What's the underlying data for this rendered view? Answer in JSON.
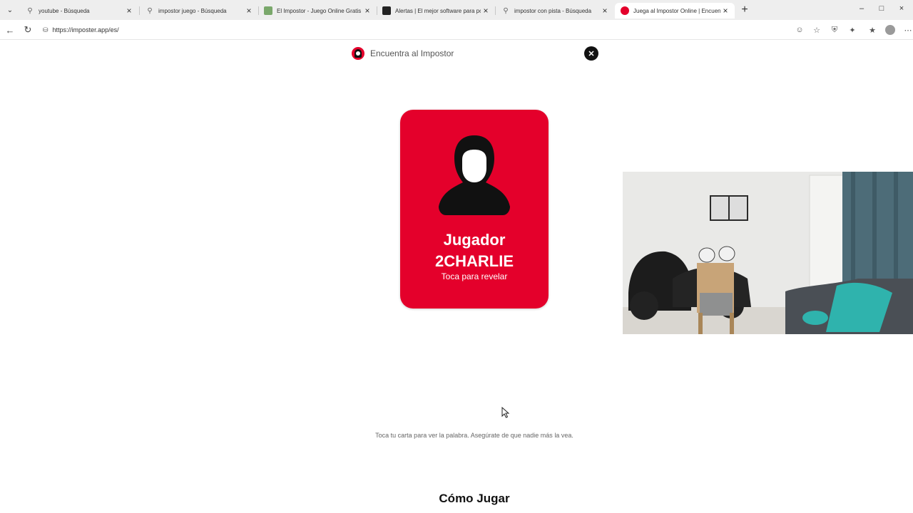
{
  "browser": {
    "tabs": [
      {
        "title": "youtube - Búsqueda",
        "icon": "search-icon",
        "active": false
      },
      {
        "title": "impostor juego - Búsqueda",
        "icon": "search-icon",
        "active": false
      },
      {
        "title": "El Impostor - Juego Online Gratis c",
        "icon": "site-icon",
        "active": false
      },
      {
        "title": "Alertas | El mejor software para pol",
        "icon": "site-icon",
        "active": false
      },
      {
        "title": "impostor con pista - Búsqueda",
        "icon": "search-icon",
        "active": false
      },
      {
        "title": "Juega al Impostor Online | Encuent",
        "icon": "impostor-logo-icon",
        "active": true
      }
    ],
    "url": "https://imposter.app/es/"
  },
  "page": {
    "site_title": "Encuentra al Impostor",
    "card": {
      "name": "Jugador 2CHARLIE",
      "hint": "Toca para revelar",
      "color": "#e4002b"
    },
    "instructions": "Toca tu carta para ver la palabra. Asegúrate de que nadie más la vea.",
    "how_to_play_title": "Cómo Jugar"
  }
}
